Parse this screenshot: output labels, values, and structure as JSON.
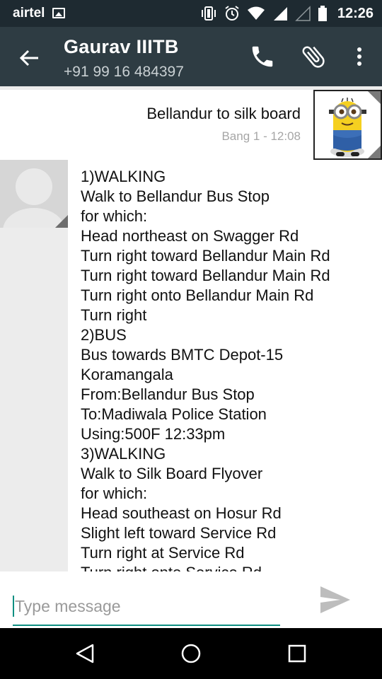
{
  "status_bar": {
    "carrier": "airtel",
    "time": "12:26",
    "icons": [
      "image-icon",
      "vibrate-icon",
      "alarm-icon",
      "wifi-icon",
      "signal-icon",
      "signal-empty-icon",
      "battery-icon"
    ]
  },
  "header": {
    "contact_name": "Gaurav IIITB",
    "phone": "+91 99 16 484397",
    "actions": [
      "back-arrow-icon",
      "phone-icon",
      "attachment-icon",
      "overflow-menu-icon"
    ]
  },
  "messages": {
    "outgoing": {
      "text": "Bellandur to silk board",
      "meta": "Bang 1 - 12:08"
    },
    "incoming": {
      "lines": [
        "1)WALKING",
        "Walk to Bellandur Bus Stop",
        "for which:",
        "Head northeast on Swagger Rd",
        "Turn right toward Bellandur Main Rd",
        "Turn right toward Bellandur Main Rd",
        "Turn right onto Bellandur Main Rd",
        "Turn right",
        "2)BUS",
        "Bus towards BMTC Depot-15",
        "Koramangala",
        "From:Bellandur Bus Stop",
        "To:Madiwala Police Station",
        "Using:500F 12:33pm",
        "3)WALKING",
        "Walk to Silk Board Flyover",
        "for which:",
        "Head southeast on Hosur Rd",
        "Slight left toward Service Rd",
        "Turn right at Service Rd",
        "Turn right onto Service Rd"
      ]
    }
  },
  "composer": {
    "placeholder": "Type message",
    "value": ""
  },
  "colors": {
    "status_bar": "#1e2a31",
    "header": "#2e3c43",
    "accent": "#0f8f82",
    "background": "#ececec"
  }
}
